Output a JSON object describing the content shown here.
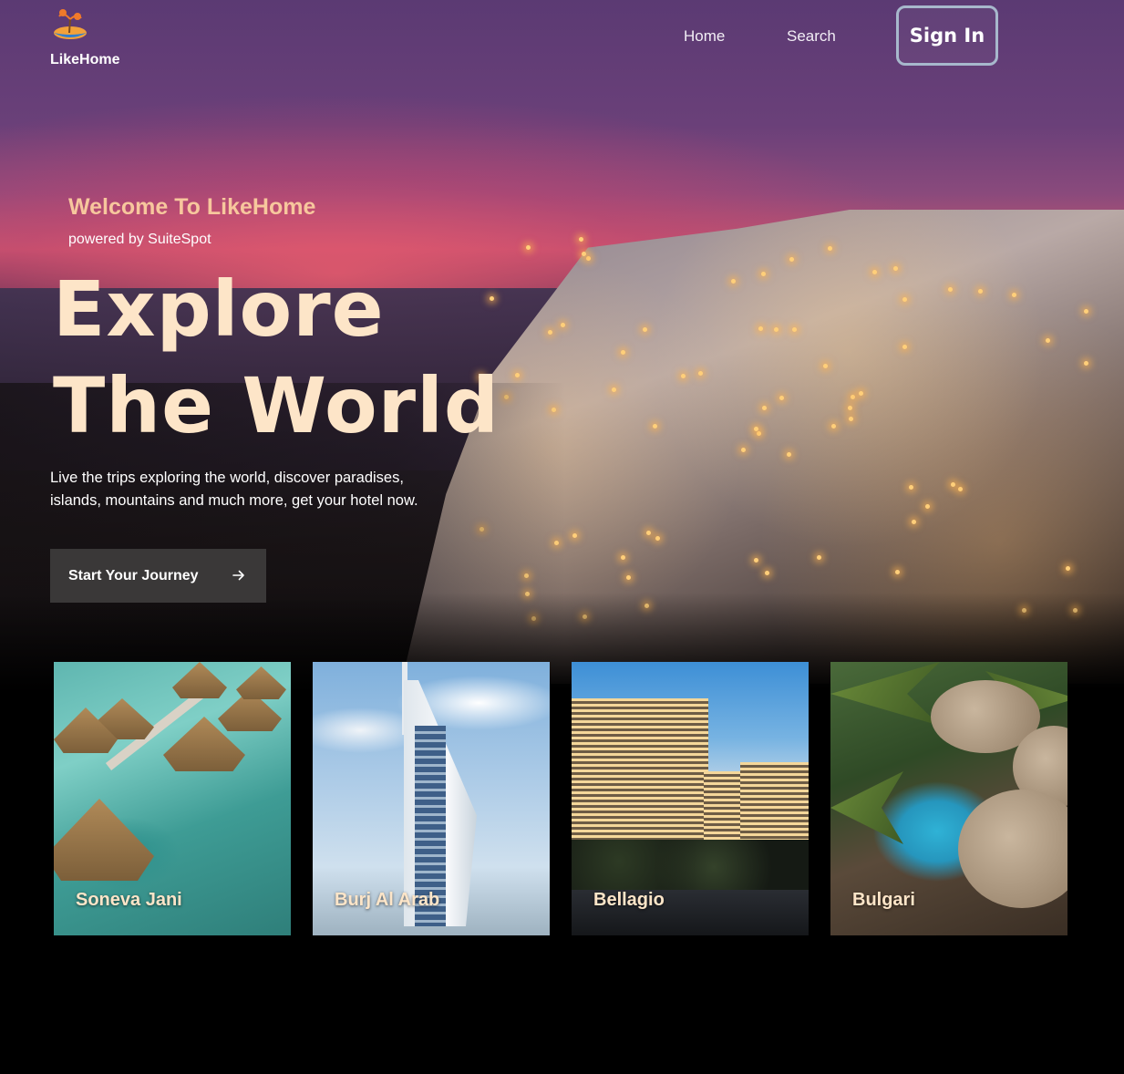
{
  "brand": {
    "name": "LikeHome",
    "logo_icon": "island-palm-icon"
  },
  "nav": {
    "home_label": "Home",
    "search_label": "Search",
    "signin_label": "Sign In"
  },
  "hero": {
    "welcome": "Welcome To LikeHome",
    "powered_by": "powered by SuiteSpot",
    "headline_line1": "Explore",
    "headline_line2": "The World",
    "description_line1": "Live the trips exploring the world, discover paradises,",
    "description_line2": "islands, mountains and much more, get your hotel now.",
    "cta_label": "Start Your Journey",
    "cta_icon": "arrow-right-icon"
  },
  "hotels": [
    {
      "name": "Soneva Jani"
    },
    {
      "name": "Burj Al Arab"
    },
    {
      "name": "Bellagio"
    },
    {
      "name": "Bulgari"
    }
  ],
  "colors": {
    "headline": "#fde5c8",
    "welcome": "#f7c79d",
    "cta_bg": "#3a3838",
    "signin_border": "#a7b8cc"
  }
}
